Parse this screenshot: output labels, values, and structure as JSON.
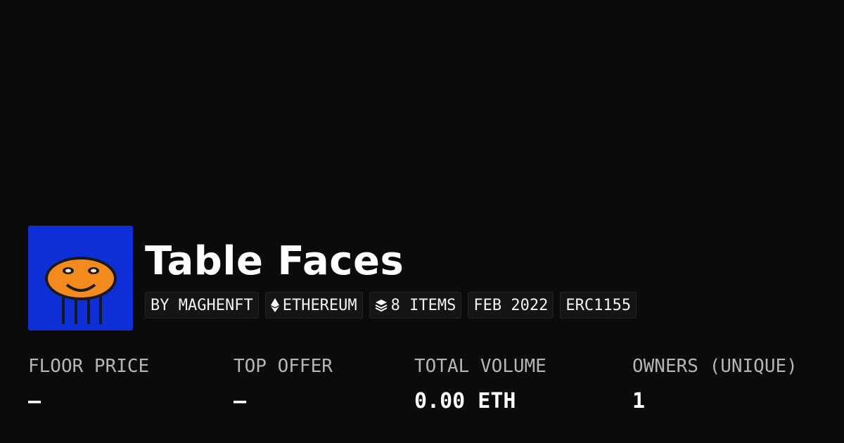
{
  "collection": {
    "title": "Table Faces",
    "tags": {
      "creator": "BY MAGHENFT",
      "chain": "ETHEREUM",
      "items": "8 ITEMS",
      "date": "FEB 2022",
      "standard": "ERC1155"
    },
    "icons": {
      "chain": "ethereum-icon",
      "items": "layers-icon"
    }
  },
  "stats": {
    "floor_price": {
      "label": "FLOOR PRICE",
      "value": "–"
    },
    "top_offer": {
      "label": "TOP OFFER",
      "value": "–"
    },
    "total_volume": {
      "label": "TOTAL VOLUME",
      "value": "0.00 ETH"
    },
    "owners": {
      "label": "OWNERS (UNIQUE)",
      "value": "1"
    }
  },
  "colors": {
    "background": "#0b0b0b",
    "avatar_bg": "#0f2fd6",
    "avatar_face": "#f28a1e",
    "label": "#b5b5b5"
  }
}
